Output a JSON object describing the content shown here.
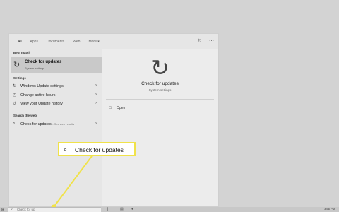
{
  "tabs": [
    "All",
    "Apps",
    "Documents",
    "Web",
    "More"
  ],
  "best_match": {
    "section_label": "Best match",
    "title": "Check for updates",
    "subtitle": "System settings",
    "icon": "sync-icon"
  },
  "settings": {
    "section_label": "Settings",
    "items": [
      {
        "label": "Windows Update settings",
        "icon": "sync-icon"
      },
      {
        "label": "Change active hours",
        "icon": "clock-icon"
      },
      {
        "label": "View your Update history",
        "icon": "history-icon"
      }
    ]
  },
  "web": {
    "section_label": "Search the web",
    "query": "Check for updates",
    "suffix": "- See web results"
  },
  "right_panel": {
    "title": "Check for updates",
    "subtitle": "System settings",
    "action_label": "Open"
  },
  "callout": {
    "label": "Check for updates"
  },
  "taskbar": {
    "search_text": "Check for up",
    "time": "3:56 PM"
  }
}
